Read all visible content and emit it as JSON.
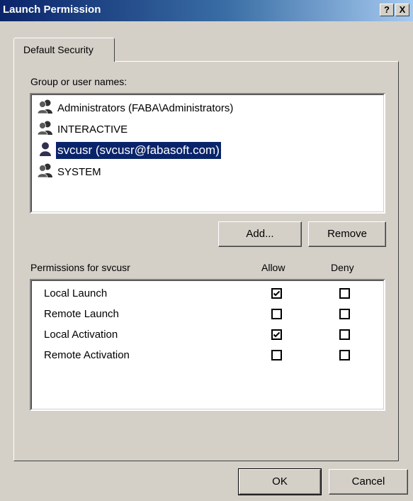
{
  "window": {
    "title": "Launch Permission",
    "help_button": "?",
    "close_button": "X"
  },
  "tab": {
    "label": "Default Security"
  },
  "groups": {
    "label": "Group or user names:",
    "items": [
      {
        "name": "Administrators (FABA\\Administrators)",
        "icon": "group-icon",
        "selected": false
      },
      {
        "name": "INTERACTIVE",
        "icon": "group-icon",
        "selected": false
      },
      {
        "name": "svcusr (svcusr@fabasoft.com)",
        "icon": "user-icon",
        "selected": true
      },
      {
        "name": "SYSTEM",
        "icon": "group-icon",
        "selected": false
      }
    ]
  },
  "buttons": {
    "add": "Add...",
    "remove": "Remove",
    "ok": "OK",
    "cancel": "Cancel"
  },
  "permissions": {
    "label": "Permissions for svcusr",
    "allow_header": "Allow",
    "deny_header": "Deny",
    "rows": [
      {
        "name": "Local Launch",
        "allow": true,
        "deny": false
      },
      {
        "name": "Remote Launch",
        "allow": false,
        "deny": false
      },
      {
        "name": "Local Activation",
        "allow": true,
        "deny": false
      },
      {
        "name": "Remote Activation",
        "allow": false,
        "deny": false
      }
    ]
  },
  "colors": {
    "selection": "#0a246a",
    "face": "#d4d0c8",
    "title_start": "#0a246a",
    "title_end": "#a6caf0"
  }
}
